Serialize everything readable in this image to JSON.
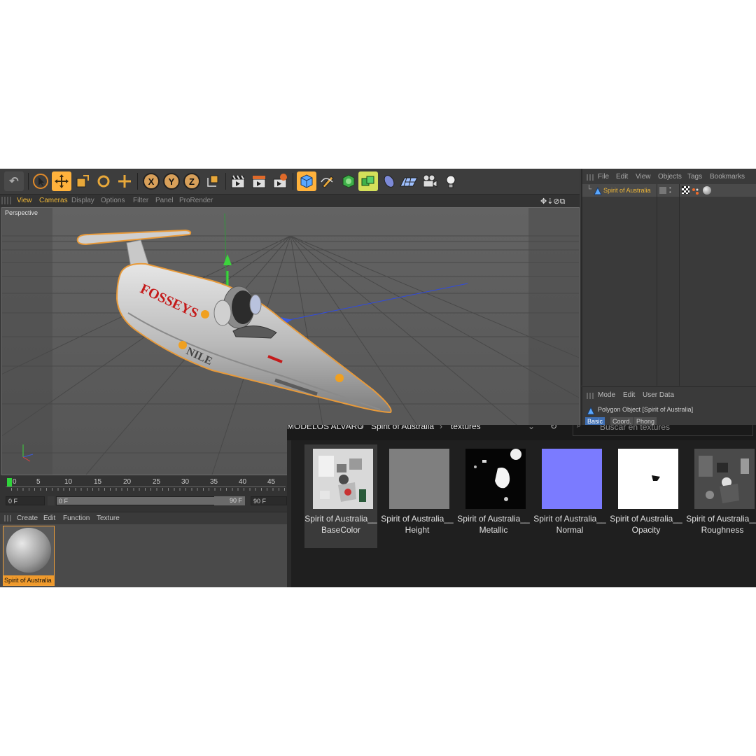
{
  "toolbar": {
    "tools": [
      {
        "name": "live-selection-icon"
      },
      {
        "name": "move-icon"
      },
      {
        "name": "scale-icon"
      },
      {
        "name": "rotate-icon"
      },
      {
        "name": "add-icon"
      }
    ],
    "axes": [
      "X",
      "Y",
      "Z"
    ],
    "render_icons": [
      "render-view-icon",
      "render-picture-viewer-icon",
      "render-settings-icon"
    ],
    "object_icons": [
      "cube-icon",
      "pen-icon",
      "subdivision-icon",
      "array-icon",
      "deformer-icon",
      "floor-icon",
      "camera-icon",
      "light-icon"
    ]
  },
  "viewport": {
    "menu": [
      "View",
      "Cameras",
      "Display",
      "Options",
      "Filter",
      "Panel",
      "ProRender"
    ],
    "label": "Perspective",
    "decals": {
      "brand": "FOSSEYS",
      "nile": "NILE"
    }
  },
  "timeline": {
    "ticks": [
      "0",
      "5",
      "10",
      "15",
      "20",
      "25",
      "30",
      "35",
      "40",
      "45"
    ],
    "start_field": "0 F",
    "range_start": "0 F",
    "range_end": "90 F",
    "end_field": "90 F"
  },
  "material_manager": {
    "menu": [
      "Create",
      "Edit",
      "Function",
      "Texture"
    ],
    "material_name": "Spirit of Australia"
  },
  "object_manager": {
    "menu": [
      "File",
      "Edit",
      "View",
      "Objects",
      "Tags",
      "Bookmarks"
    ],
    "object_name": "Spirit of Australia"
  },
  "attribute_manager": {
    "menu": [
      "Mode",
      "Edit",
      "User Data"
    ],
    "title": "Polygon Object [Spirit of Australia]",
    "tabs": [
      "Basic",
      "Coord.",
      "Phong"
    ]
  },
  "explorer": {
    "breadcrumb": [
      "MODELOS ALVARO",
      "Spirit of Australia",
      "textures"
    ],
    "search_placeholder": "Buscar en textures",
    "files": [
      {
        "label": "Spirit of Australia__BaseColor",
        "thumb": "basecolor"
      },
      {
        "label": "Spirit of Australia__Height",
        "thumb": "height"
      },
      {
        "label": "Spirit of Australia__Metallic",
        "thumb": "metallic"
      },
      {
        "label": "Spirit of Australia__Normal",
        "thumb": "normal"
      },
      {
        "label": "Spirit of Australia__Opacity",
        "thumb": "opacity"
      },
      {
        "label": "Spirit of Australia__Roughness",
        "thumb": "roughness"
      }
    ]
  },
  "colors": {
    "accent": "#f0b838",
    "selection": "#ffb23c",
    "normal_map": "#7b7bff"
  }
}
